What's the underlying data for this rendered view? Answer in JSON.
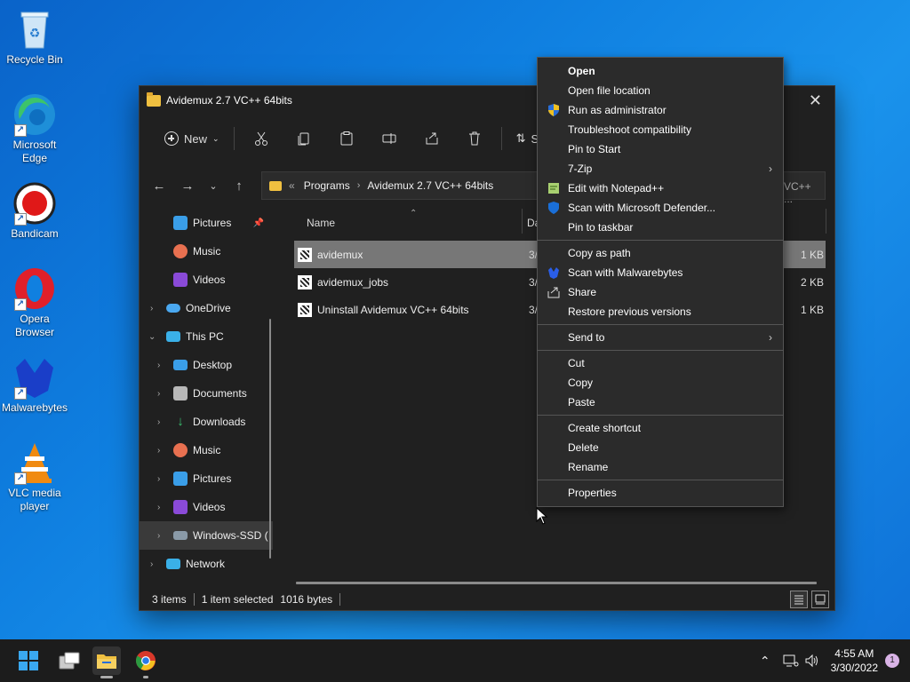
{
  "desktop": {
    "icons": [
      {
        "label": "Recycle Bin"
      },
      {
        "label": "Microsoft Edge"
      },
      {
        "label": "Bandicam"
      },
      {
        "label": "Opera Browser"
      },
      {
        "label": "Malwarebytes"
      },
      {
        "label": "VLC media player"
      }
    ]
  },
  "window": {
    "title": "Avidemux 2.7 VC++ 64bits",
    "toolbar": {
      "new_label": "New",
      "sort_label": "So"
    },
    "address": {
      "prefix": "«",
      "crumbs": [
        "Programs",
        "Avidemux 2.7 VC++ 64bits"
      ],
      "search_stub": "VC++ ..."
    },
    "nav": [
      {
        "label": "Pictures",
        "pinned": true
      },
      {
        "label": "Music"
      },
      {
        "label": "Videos"
      },
      {
        "label": "OneDrive"
      },
      {
        "label": "This PC"
      },
      {
        "label": "Desktop"
      },
      {
        "label": "Documents"
      },
      {
        "label": "Downloads"
      },
      {
        "label": "Music"
      },
      {
        "label": "Pictures"
      },
      {
        "label": "Videos"
      },
      {
        "label": "Windows-SSD ("
      },
      {
        "label": "Network"
      }
    ],
    "columns": {
      "name": "Name",
      "date": "Da"
    },
    "files": [
      {
        "name": "avidemux",
        "date": "3/",
        "size": "1 KB"
      },
      {
        "name": "avidemux_jobs",
        "date": "3/",
        "size": "2 KB"
      },
      {
        "name": "Uninstall Avidemux VC++ 64bits",
        "date": "3/",
        "size": "1 KB"
      }
    ],
    "status": {
      "count": "3 items",
      "selected": "1 item selected",
      "bytes": "1016 bytes"
    }
  },
  "context_menu": {
    "items": [
      "Open",
      "Open file location",
      "Run as administrator",
      "Troubleshoot compatibility",
      "Pin to Start",
      "7-Zip",
      "Edit with Notepad++",
      "Scan with Microsoft Defender...",
      "Pin to taskbar",
      "Copy as path",
      "Scan with Malwarebytes",
      "Share",
      "Restore previous versions",
      "Send to",
      "Cut",
      "Copy",
      "Paste",
      "Create shortcut",
      "Delete",
      "Rename",
      "Properties"
    ],
    "submenu_glyph": "›"
  },
  "taskbar": {
    "time": "4:55 AM",
    "date": "3/30/2022",
    "notifications": "1"
  },
  "colors": {
    "desktop_bg": "#0f7fe0",
    "window_bg": "#202020",
    "menu_bg": "#2b2b2b",
    "selection": "#777777",
    "taskbar_bg": "#1c1c1c"
  }
}
